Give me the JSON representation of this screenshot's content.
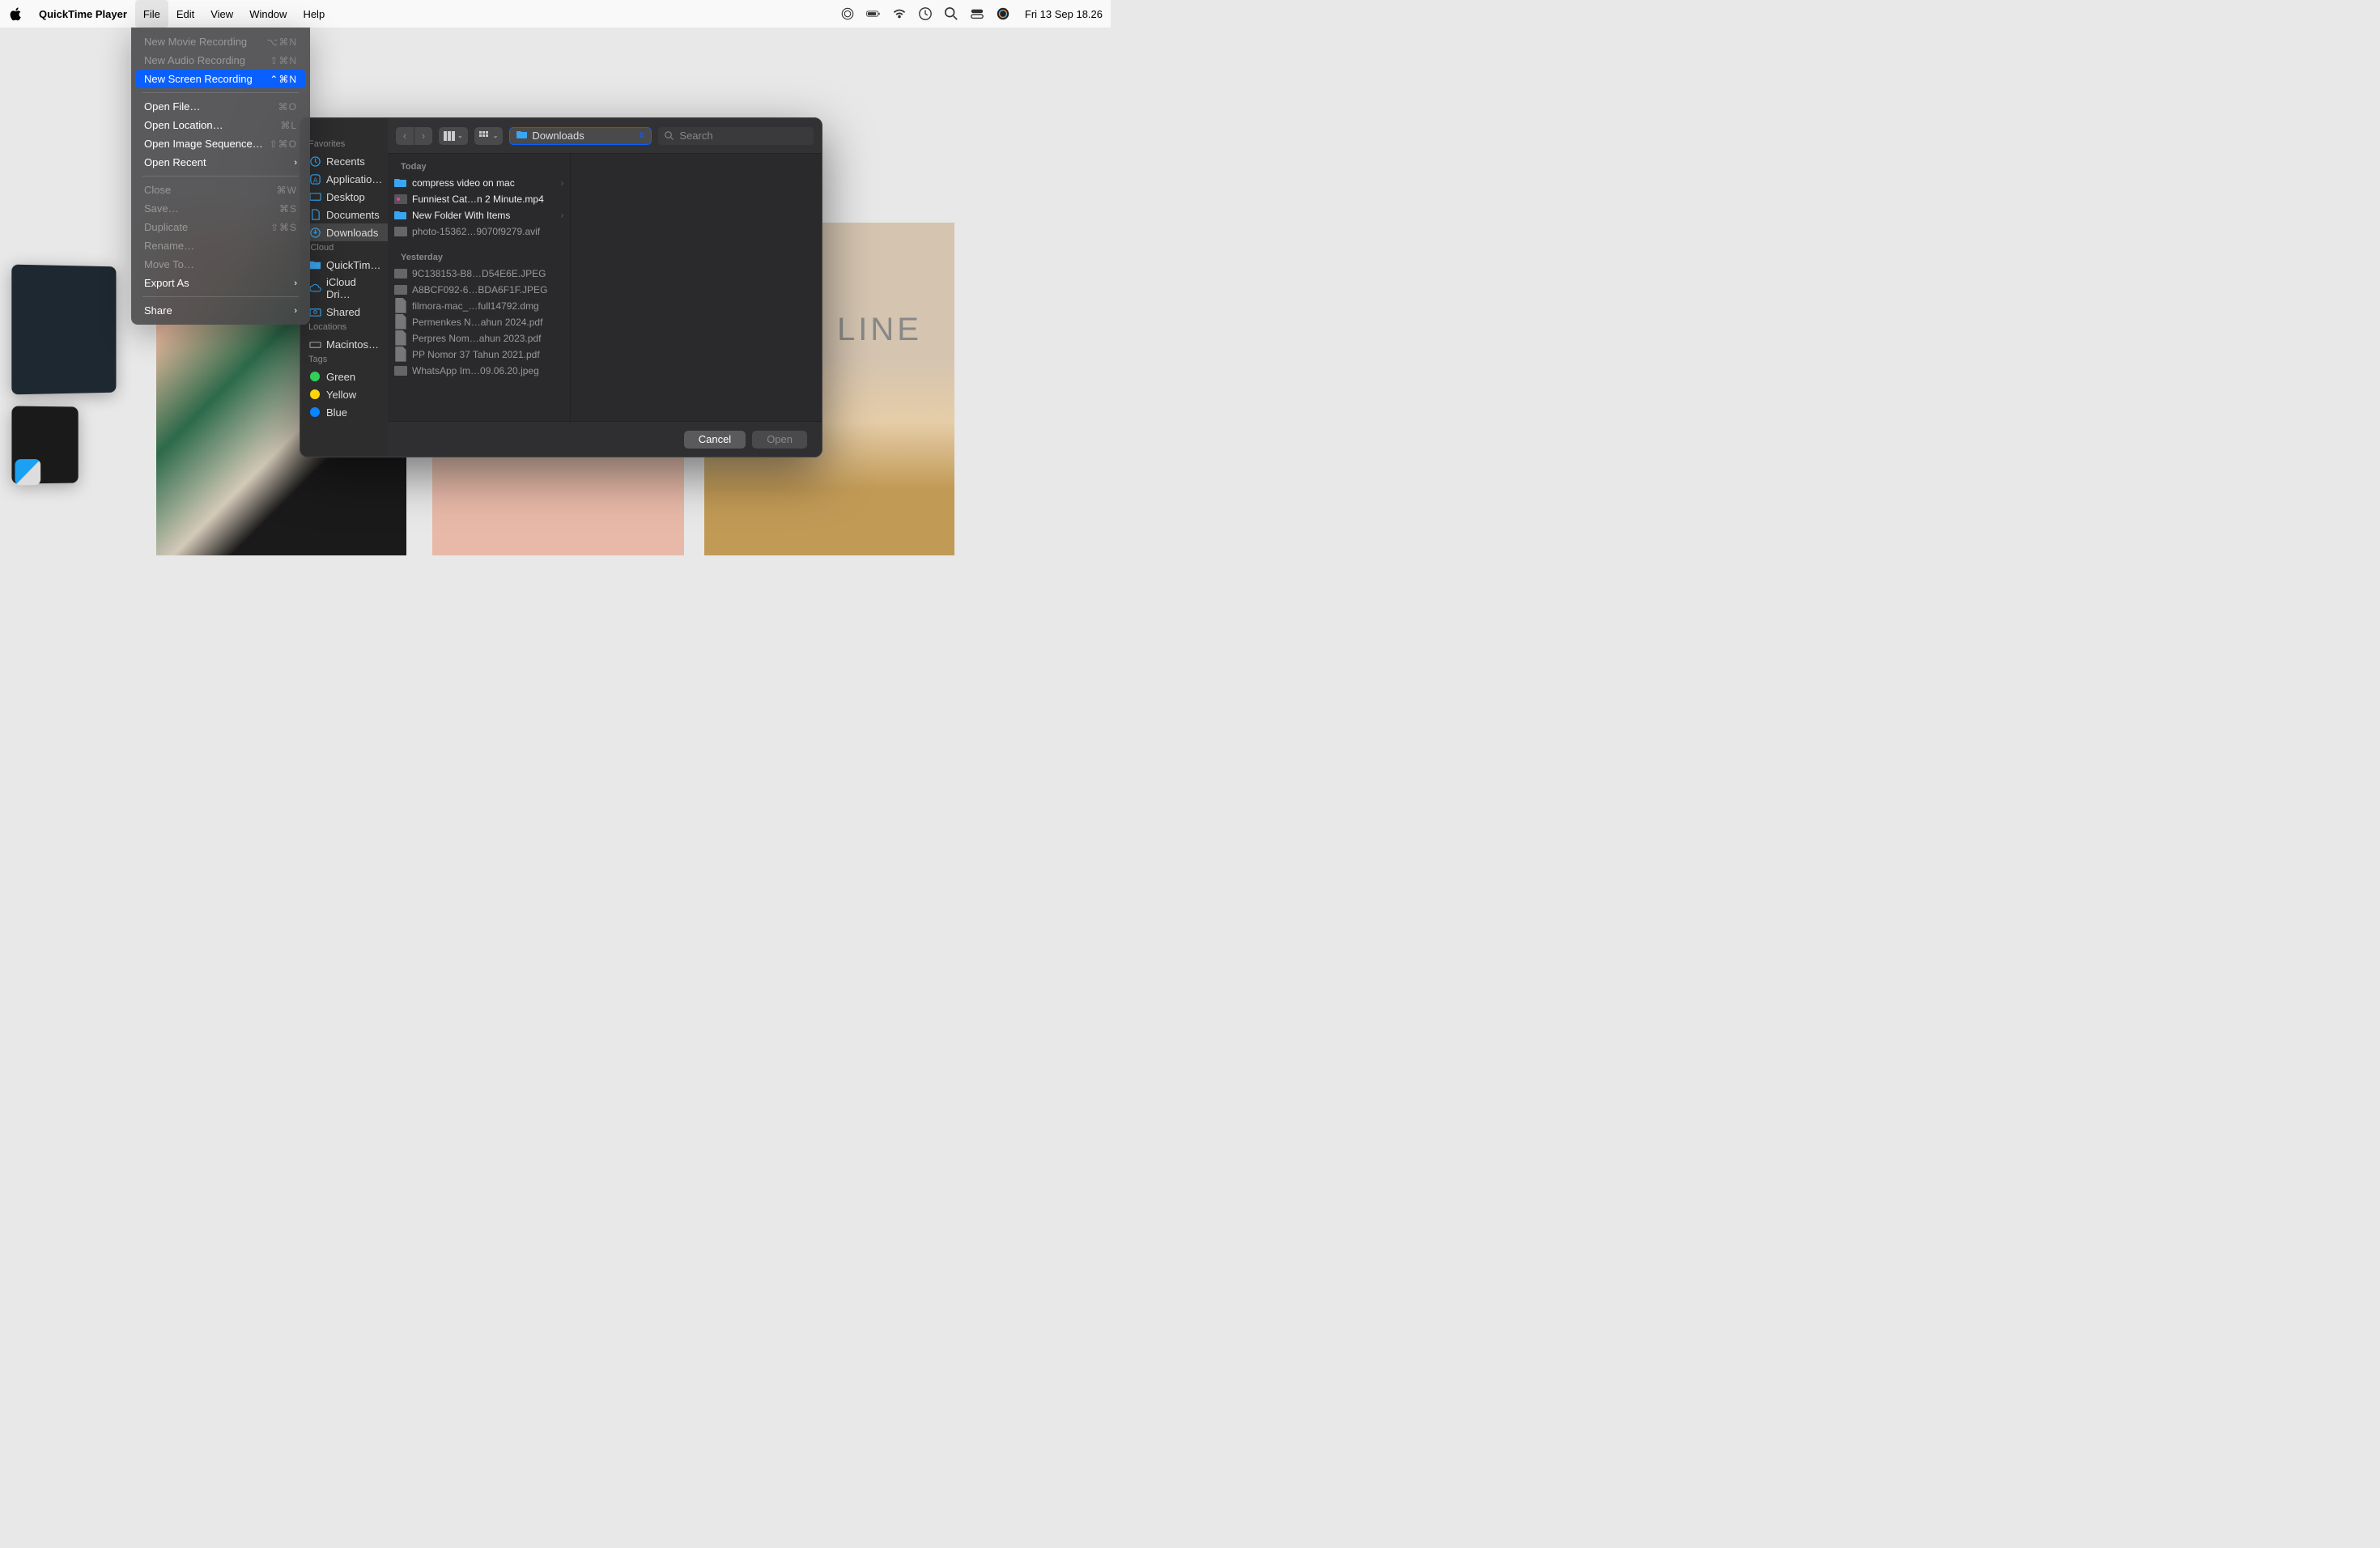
{
  "menubar": {
    "app_name": "QuickTime Player",
    "menus": [
      "File",
      "Edit",
      "View",
      "Window",
      "Help"
    ],
    "active_menu": "File",
    "datetime": "Fri 13 Sep  18.26"
  },
  "dropdown": {
    "items": [
      {
        "label": "New Movie Recording",
        "shortcut": "⌥⌘N",
        "enabled": false
      },
      {
        "label": "New Audio Recording",
        "shortcut": "⇧⌘N",
        "enabled": false
      },
      {
        "label": "New Screen Recording",
        "shortcut": "⌃⌘N",
        "enabled": true,
        "highlighted": true
      },
      {
        "sep": true
      },
      {
        "label": "Open File…",
        "shortcut": "⌘O",
        "enabled": true
      },
      {
        "label": "Open Location…",
        "shortcut": "⌘L",
        "enabled": true
      },
      {
        "label": "Open Image Sequence…",
        "shortcut": "⇧⌘O",
        "enabled": true
      },
      {
        "label": "Open Recent",
        "submenu": true,
        "enabled": true
      },
      {
        "sep": true
      },
      {
        "label": "Close",
        "shortcut": "⌘W",
        "enabled": false
      },
      {
        "label": "Save…",
        "shortcut": "⌘S",
        "enabled": false
      },
      {
        "label": "Duplicate",
        "shortcut": "⇧⌘S",
        "enabled": false
      },
      {
        "label": "Rename…",
        "enabled": false
      },
      {
        "label": "Move To…",
        "enabled": false
      },
      {
        "label": "Export As",
        "submenu": true,
        "enabled": true
      },
      {
        "sep": true
      },
      {
        "label": "Share",
        "submenu": true,
        "enabled": true
      }
    ]
  },
  "dialog": {
    "sidebar": {
      "sections": [
        {
          "header": "Favorites",
          "items": [
            {
              "label": "Recents",
              "icon": "clock"
            },
            {
              "label": "Applicatio…",
              "icon": "app"
            },
            {
              "label": "Desktop",
              "icon": "desktop"
            },
            {
              "label": "Documents",
              "icon": "doc"
            },
            {
              "label": "Downloads",
              "icon": "download",
              "selected": true
            }
          ]
        },
        {
          "header": "iCloud",
          "items": [
            {
              "label": "QuickTim…",
              "icon": "folder"
            },
            {
              "label": "iCloud Dri…",
              "icon": "cloud"
            },
            {
              "label": "Shared",
              "icon": "shared"
            }
          ]
        },
        {
          "header": "Locations",
          "items": [
            {
              "label": "Macintos…",
              "icon": "disk"
            }
          ]
        },
        {
          "header": "Tags",
          "items": [
            {
              "label": "Green",
              "color": "#30d158"
            },
            {
              "label": "Yellow",
              "color": "#ffd60a"
            },
            {
              "label": "Blue",
              "color": "#0a84ff"
            }
          ]
        }
      ]
    },
    "toolbar": {
      "location": "Downloads",
      "search_placeholder": "Search"
    },
    "files": {
      "groups": [
        {
          "header": "Today",
          "items": [
            {
              "name": "compress video on mac",
              "type": "folder",
              "active": true
            },
            {
              "name": "Funniest Cat…n 2 Minute.mp4",
              "type": "video",
              "active": true
            },
            {
              "name": "New Folder With Items",
              "type": "folder",
              "active": true
            },
            {
              "name": "photo-15362…9070f9279.avif",
              "type": "image",
              "active": false
            }
          ]
        },
        {
          "header": "Yesterday",
          "items": [
            {
              "name": "9C138153-B8…D54E6E.JPEG",
              "type": "image",
              "active": false
            },
            {
              "name": "A8BCF092-6…BDA6F1F.JPEG",
              "type": "image",
              "active": false
            },
            {
              "name": "filmora-mac_…full14792.dmg",
              "type": "doc",
              "active": false
            },
            {
              "name": "Permenkes N…ahun 2024.pdf",
              "type": "doc",
              "active": false
            },
            {
              "name": "Perpres Nom…ahun 2023.pdf",
              "type": "doc",
              "active": false
            },
            {
              "name": "PP Nomor 37 Tahun 2021.pdf",
              "type": "doc",
              "active": false
            },
            {
              "name": "WhatsApp Im…09.06.20.jpeg",
              "type": "image",
              "active": false
            }
          ]
        }
      ]
    },
    "footer": {
      "cancel": "Cancel",
      "open": "Open"
    }
  },
  "wallpaper_text": "LINE"
}
